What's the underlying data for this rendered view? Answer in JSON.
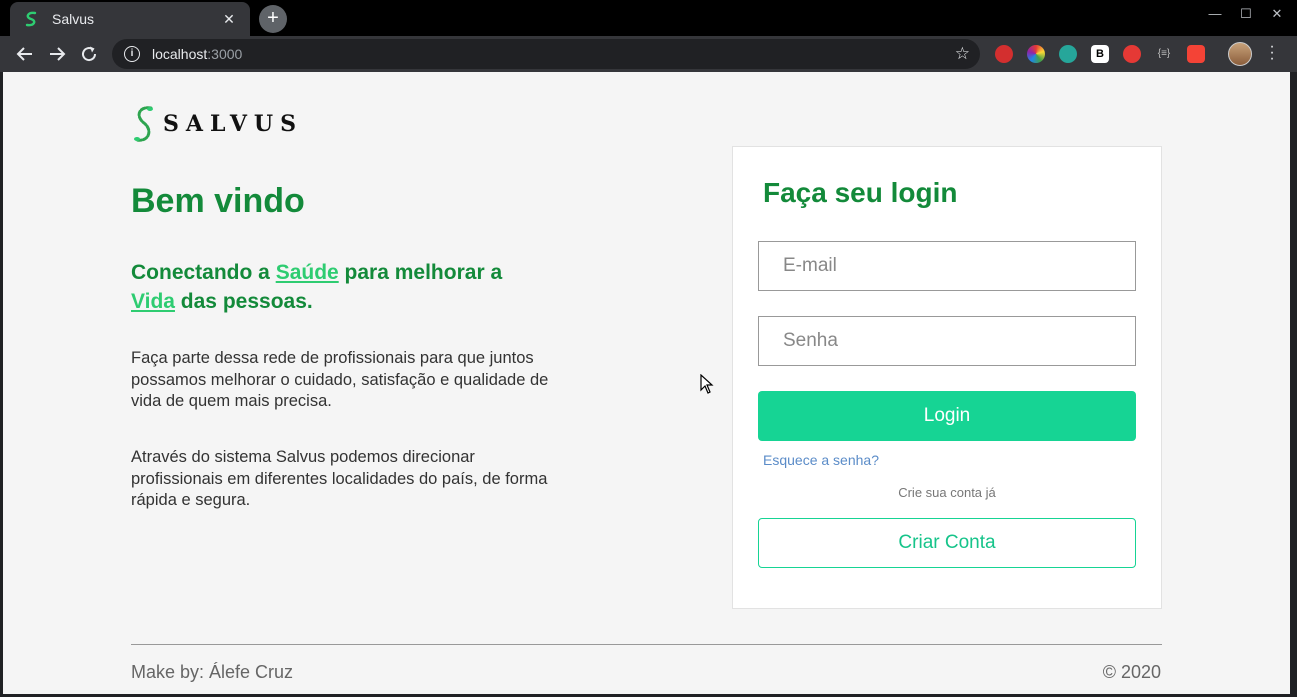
{
  "browser": {
    "tab_title": "Salvus",
    "tab_close": "✕",
    "new_tab": "+",
    "url_host": "localhost",
    "url_port": ":3000",
    "window_controls": [
      "—",
      "☐",
      "✕"
    ],
    "extensions": [
      {
        "name": "adblock-icon",
        "color": "#d32f2f"
      },
      {
        "name": "color-picker-icon",
        "color": "#8e24aa"
      },
      {
        "name": "react-devtools-icon",
        "color": "#26a69a"
      },
      {
        "name": "b-extension-icon",
        "color": "#ffffff"
      },
      {
        "name": "bug-extension-icon",
        "color": "#e53935"
      },
      {
        "name": "json-viewer-icon",
        "color": "#9e9e9e"
      },
      {
        "name": "gift-extension-icon",
        "color": "#f44336"
      }
    ]
  },
  "brand": {
    "logo_text": "SALVUS",
    "primary_color": "#138a3a",
    "accent_color": "#16d494"
  },
  "hero": {
    "title": "Bem vindo",
    "tagline_part1": "Conectando a ",
    "tagline_link1": "Saúde",
    "tagline_part2": " para melhorar a ",
    "tagline_link2": "Vida",
    "tagline_part3": " das pessoas.",
    "paragraph1": "Faça parte dessa rede de profissionais para que juntos possamos melhorar o cuidado, satisfação e qualidade de vida de quem mais precisa.",
    "paragraph2": "Através do sistema Salvus podemos direcionar profissionais em diferentes localidades do país, de forma rápida e segura."
  },
  "login": {
    "title": "Faça seu login",
    "email_placeholder": "E-mail",
    "password_placeholder": "Senha",
    "login_button": "Login",
    "forgot_link": "Esquece a senha?",
    "create_hint": "Crie sua conta já",
    "create_button": "Criar Conta"
  },
  "footer": {
    "left": "Make by: Álefe Cruz",
    "right": "© 2020"
  }
}
